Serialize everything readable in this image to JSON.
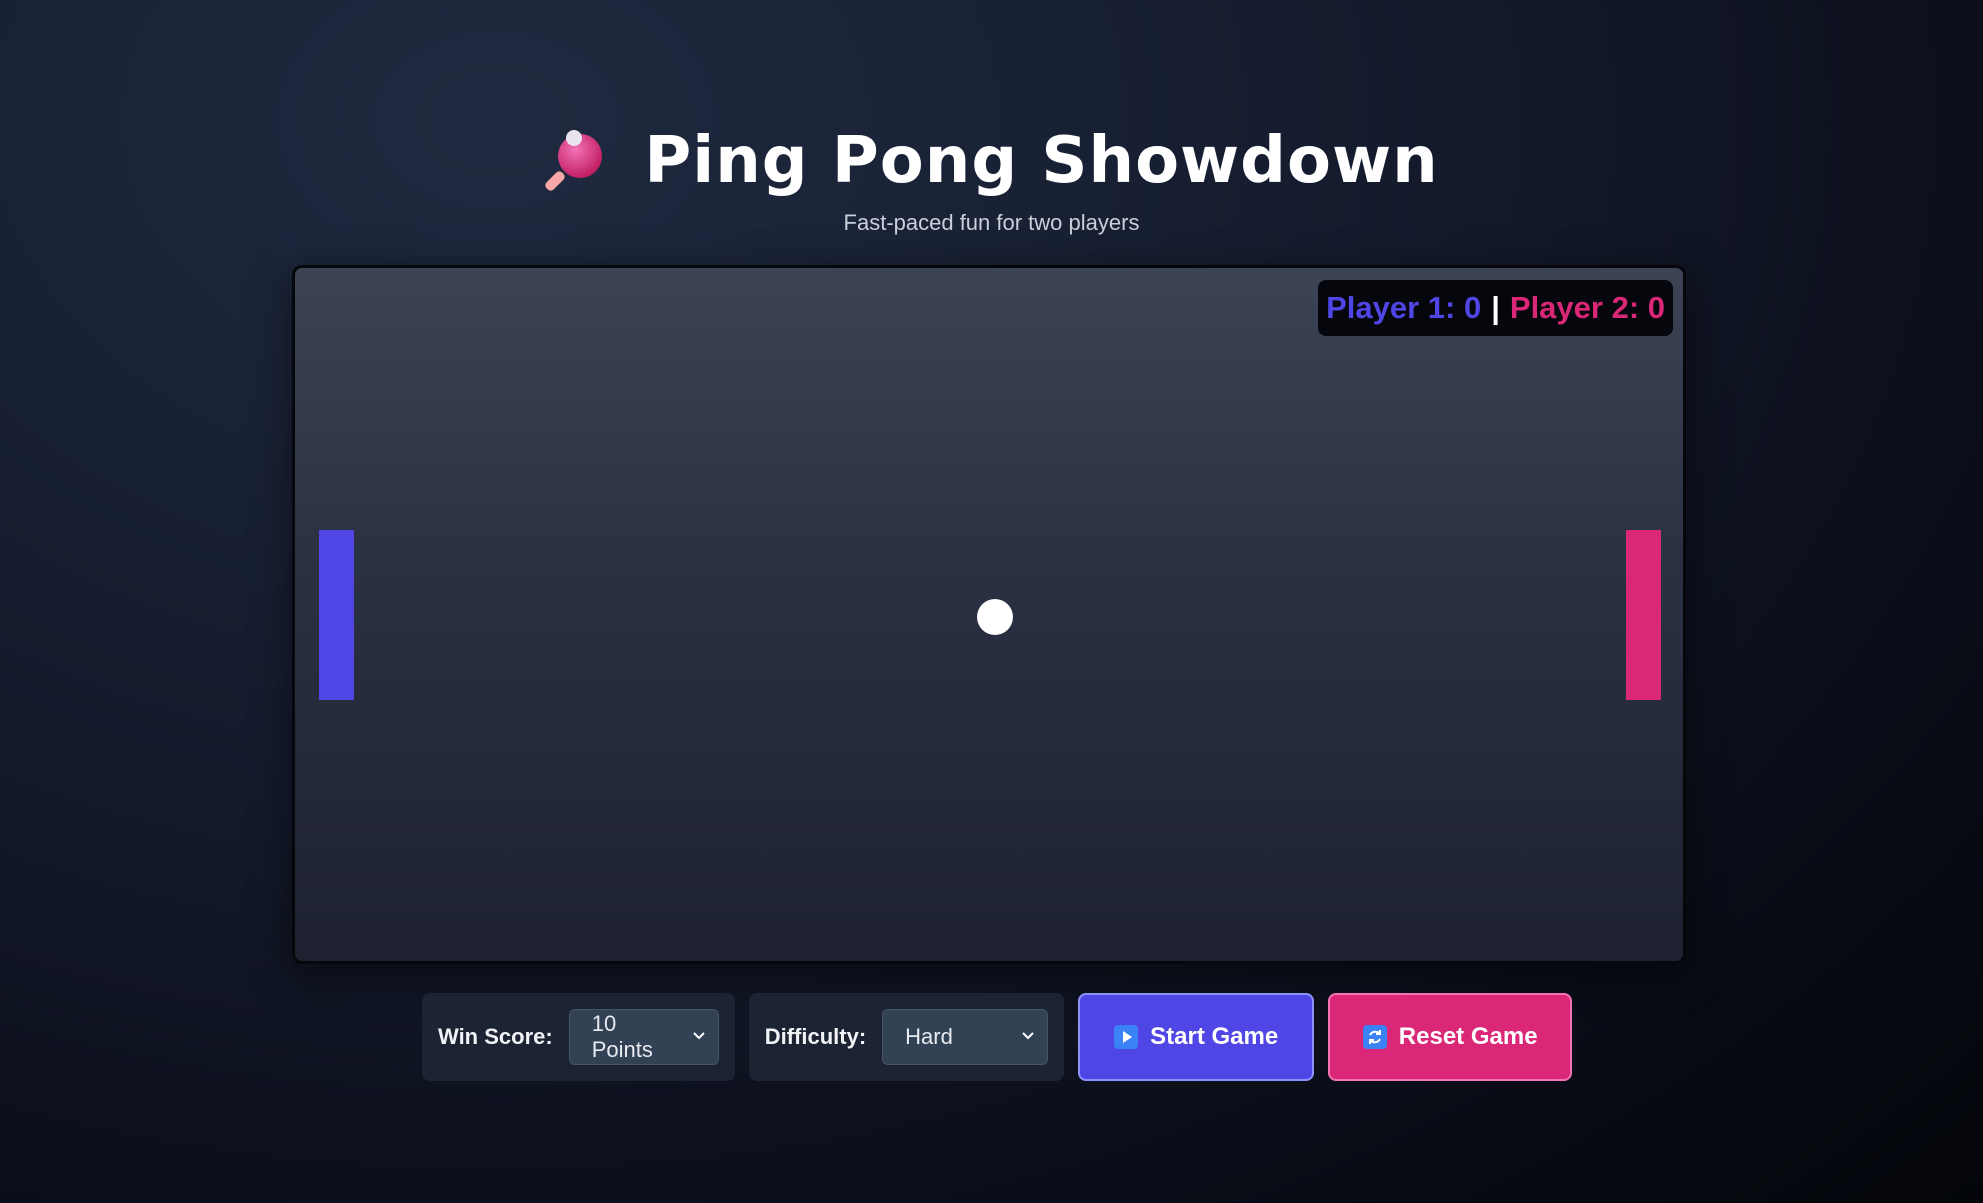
{
  "header": {
    "title": "Ping Pong Showdown",
    "subtitle": "Fast-paced fun for two players",
    "title_icon": "ping-pong-paddle-icon"
  },
  "scoreboard": {
    "player1_label": "Player 1: 0",
    "separator": "|",
    "player2_label": "Player 2: 0",
    "player1_color": "#4f46e5",
    "player2_color": "#db2777"
  },
  "game": {
    "ball_color": "#ffffff",
    "left_paddle_color": "#4f46e5",
    "right_paddle_color": "#db2777"
  },
  "controls": {
    "win_score": {
      "label": "Win Score:",
      "selected": "10 Points"
    },
    "difficulty": {
      "label": "Difficulty:",
      "selected": "Hard"
    },
    "start_button": {
      "label": "Start Game",
      "icon": "play-icon",
      "color": "#4f46e5"
    },
    "reset_button": {
      "label": "Reset Game",
      "icon": "refresh-icon",
      "color": "#db2777"
    }
  }
}
